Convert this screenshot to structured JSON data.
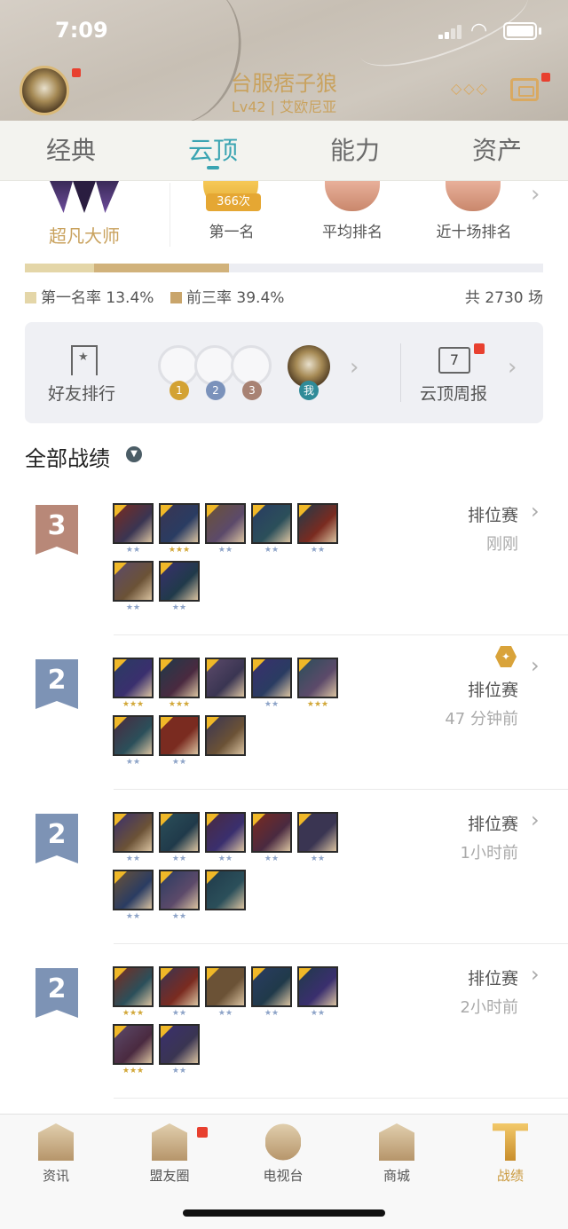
{
  "status_bar": {
    "time": "7:09"
  },
  "header": {
    "username": "台服痞子狼",
    "level_region": "Lv42 | 艾欧尼亚",
    "more_icon": "ellipsis-icon",
    "message_icon": "message-icon"
  },
  "tabs": [
    {
      "label": "经典"
    },
    {
      "label": "云顶",
      "active": true
    },
    {
      "label": "能力"
    },
    {
      "label": "资产"
    }
  ],
  "summary": {
    "rank_name": "超凡大师",
    "first_count": "366次",
    "first_label": "第一名",
    "avg_label": "平均排名",
    "recent_label": "近十场排名",
    "first_rate_label": "第一名率 13.4%",
    "first_rate": 0.134,
    "top3_rate_label": "前三率 39.4%",
    "top3_rate": 0.394,
    "total_games": "共 2730 场"
  },
  "friends_card": {
    "leaderboard_label": "好友排行",
    "ranks": [
      "1",
      "2",
      "3"
    ],
    "me_label": "我",
    "weekly_label": "云顶周报",
    "calendar_day": "7"
  },
  "matches_section": {
    "title": "全部战绩"
  },
  "matches": [
    {
      "placement": "3",
      "mode": "排位赛",
      "time": "刚刚",
      "champions": [
        {
          "stars": "★★",
          "gold": false
        },
        {
          "stars": "★★★",
          "gold": true
        },
        {
          "stars": "★★",
          "gold": false
        },
        {
          "stars": "★★",
          "gold": false
        },
        {
          "stars": "★★",
          "gold": false
        },
        {
          "stars": "★★",
          "gold": false
        },
        {
          "stars": "★★",
          "gold": false
        }
      ]
    },
    {
      "placement": "2",
      "mode": "排位赛",
      "time": "47 分钟前",
      "champions": [
        {
          "stars": "★★★",
          "gold": true
        },
        {
          "stars": "★★★",
          "gold": true
        },
        {
          "stars": "",
          "gold": false
        },
        {
          "stars": "★★",
          "gold": false
        },
        {
          "stars": "★★★",
          "gold": true
        },
        {
          "stars": "★★",
          "gold": false
        },
        {
          "stars": "★★",
          "gold": false
        },
        {
          "stars": "",
          "gold": false
        }
      ]
    },
    {
      "placement": "2",
      "mode": "排位赛",
      "time": "1小时前",
      "champions": [
        {
          "stars": "★★",
          "gold": false
        },
        {
          "stars": "★★",
          "gold": false
        },
        {
          "stars": "★★",
          "gold": false
        },
        {
          "stars": "★★",
          "gold": false
        },
        {
          "stars": "★★",
          "gold": false
        },
        {
          "stars": "★★",
          "gold": false
        },
        {
          "stars": "★★",
          "gold": false
        },
        {
          "stars": "",
          "gold": false
        }
      ]
    },
    {
      "placement": "2",
      "mode": "排位赛",
      "time": "2小时前",
      "champions": [
        {
          "stars": "★★★",
          "gold": true
        },
        {
          "stars": "★★",
          "gold": false
        },
        {
          "stars": "★★",
          "gold": false
        },
        {
          "stars": "★★",
          "gold": false
        },
        {
          "stars": "★★",
          "gold": false
        },
        {
          "stars": "★★★",
          "gold": true
        },
        {
          "stars": "★★",
          "gold": false
        }
      ]
    }
  ],
  "bottom_nav": [
    {
      "label": "资讯",
      "icon": "news-icon"
    },
    {
      "label": "盟友圈",
      "icon": "friends-circle-icon"
    },
    {
      "label": "电视台",
      "icon": "tv-icon"
    },
    {
      "label": "商城",
      "icon": "shop-icon"
    },
    {
      "label": "战绩",
      "icon": "record-icon",
      "active": true
    }
  ],
  "colors": {
    "accent_teal": "#3aa4b2",
    "gold": "#c9a25e",
    "notification_red": "#e8402f"
  }
}
